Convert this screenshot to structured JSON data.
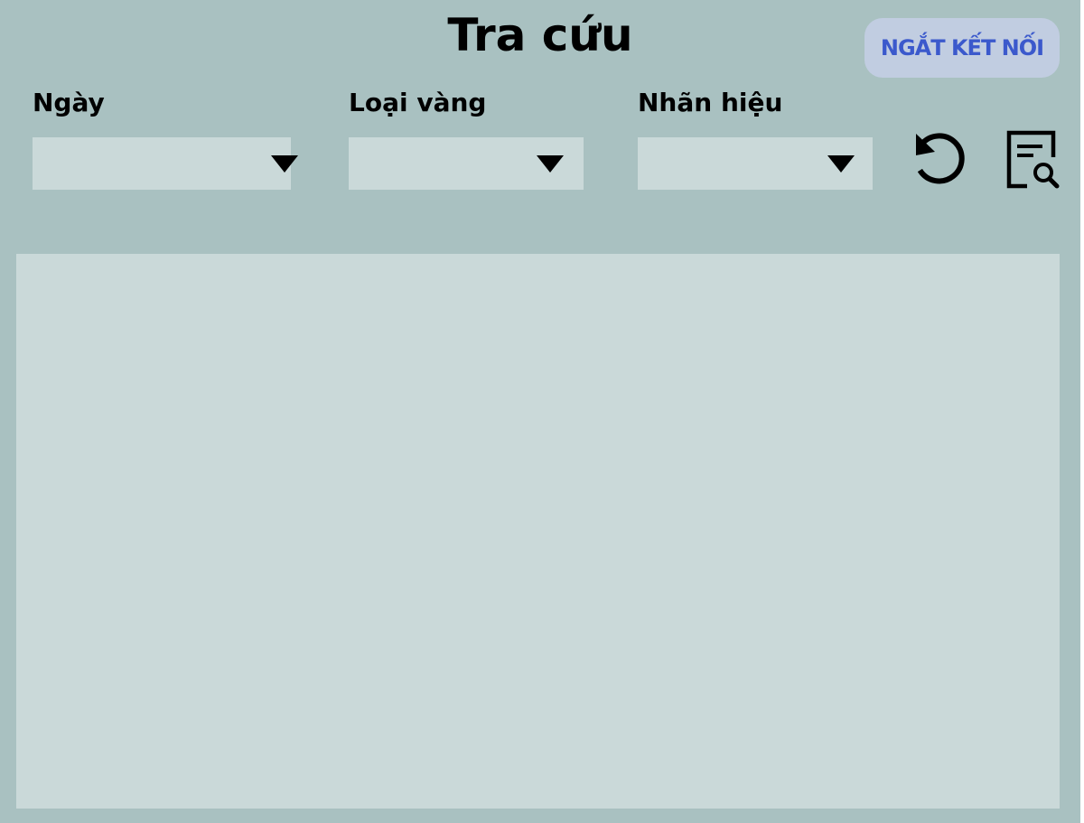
{
  "header": {
    "title": "Tra cứu",
    "disconnect_label": "NGẮT KẾT NỐI"
  },
  "filters": {
    "date": {
      "label": "Ngày",
      "value": ""
    },
    "gold_type": {
      "label": "Loại vàng",
      "value": ""
    },
    "brand": {
      "label": "Nhãn hiệu",
      "value": ""
    }
  },
  "actions": {
    "refresh_icon": "refresh-icon",
    "search_icon": "document-search-icon"
  },
  "results": {
    "rows": []
  },
  "colors": {
    "background": "#a9c1c1",
    "field": "#cad9d9",
    "button_bg": "#c1cde1",
    "button_text": "#3b59cc"
  }
}
